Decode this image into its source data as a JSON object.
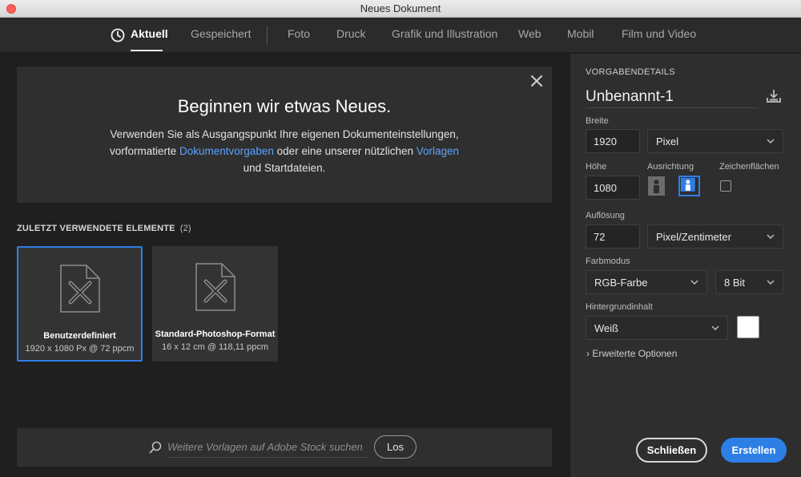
{
  "window": {
    "title": "Neues Dokument"
  },
  "nav": {
    "tabs": [
      {
        "label": "Aktuell",
        "active": true
      },
      {
        "label": "Gespeichert"
      },
      {
        "label": "Foto"
      },
      {
        "label": "Druck"
      },
      {
        "label": "Grafik und Illustration"
      },
      {
        "label": "Web"
      },
      {
        "label": "Mobil"
      },
      {
        "label": "Film und Video"
      }
    ]
  },
  "welcome": {
    "title": "Beginnen wir etwas Neues.",
    "text_1": "Verwenden Sie als Ausgangspunkt Ihre eigenen Dokumenteinstellungen,",
    "text_2": "vorformatierte",
    "link_presets": "Dokumentvorgaben",
    "text_3": "oder eine unserer nützlichen",
    "link_templates": "Vorlagen",
    "text_4": "und Startdateien."
  },
  "recent": {
    "heading": "ZULETZT VERWENDETE ELEMENTE",
    "count": "(2)",
    "items": [
      {
        "name": "Benutzerdefiniert",
        "meta": "1920 x 1080 Px @ 72 ppcm",
        "selected": true
      },
      {
        "name": "Standard-Photoshop-Format",
        "meta": "16 x 12 cm @ 118,11 ppcm",
        "selected": false
      }
    ]
  },
  "search": {
    "placeholder": "Weitere Vorlagen auf Adobe Stock suchen",
    "button": "Los"
  },
  "details": {
    "section_title": "VORGABENDETAILS",
    "doc_name": "Unbenannt-1",
    "width_label": "Breite",
    "width_value": "1920",
    "width_unit": "Pixel",
    "height_label": "Höhe",
    "height_value": "1080",
    "orientation_label": "Ausrichtung",
    "artboards_label": "Zeichenflächen",
    "resolution_label": "Auflösung",
    "resolution_value": "72",
    "resolution_unit": "Pixel/Zentimeter",
    "color_mode_label": "Farbmodus",
    "color_mode_value": "RGB-Farbe",
    "bit_depth_value": "8 Bit",
    "background_label": "Hintergrundinhalt",
    "background_value": "Weiß",
    "background_color": "#ffffff",
    "advanced_label": "Erweiterte Optionen"
  },
  "actions": {
    "close": "Schließen",
    "create": "Erstellen"
  },
  "colors": {
    "accent": "#2d7fe6",
    "link": "#5ca1ff"
  }
}
